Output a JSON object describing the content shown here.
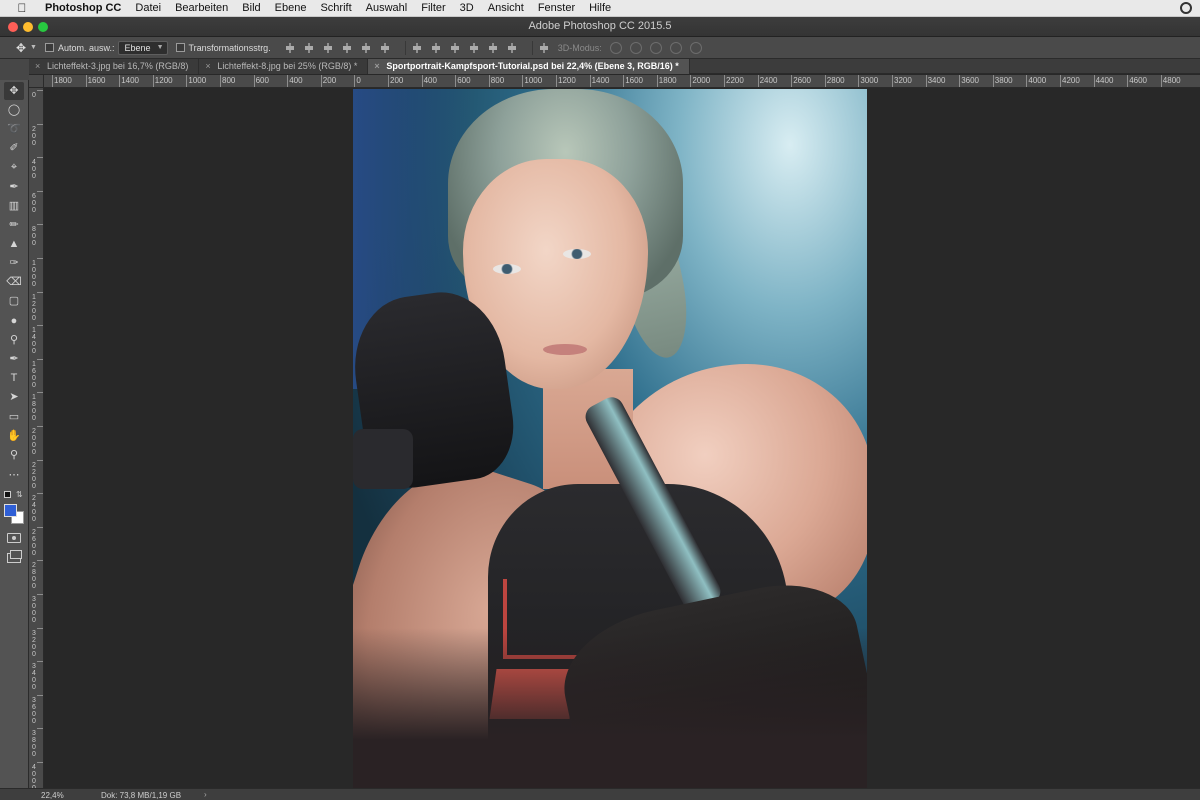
{
  "menubar": {
    "items": [
      "Photoshop CC",
      "Datei",
      "Bearbeiten",
      "Bild",
      "Ebene",
      "Schrift",
      "Auswahl",
      "Filter",
      "3D",
      "Ansicht",
      "Fenster",
      "Hilfe"
    ]
  },
  "window": {
    "title": "Adobe Photoshop CC 2015.5"
  },
  "options": {
    "auto_select_label": "Autom. ausw.:",
    "auto_select_value": "Ebene",
    "transform_label": "Transformationsstrg.",
    "mode_3d_label": "3D-Modus:"
  },
  "tabs": [
    {
      "label": "Lichteffekt-3.jpg bei 16,7% (RGB/8)",
      "active": false
    },
    {
      "label": "Lichteffekt-8.jpg bei 25% (RGB/8) *",
      "active": false
    },
    {
      "label": "Sportportrait-Kampfsport-Tutorial.psd bei 22,4% (Ebene 3, RGB/16) *",
      "active": true
    }
  ],
  "ruler": {
    "h_labels": [
      "1800",
      "1600",
      "1400",
      "1200",
      "1000",
      "800",
      "600",
      "400",
      "200",
      "0",
      "200",
      "400",
      "600",
      "800",
      "1000",
      "1200",
      "1400",
      "1600",
      "1800",
      "2000",
      "2200",
      "2400",
      "2600",
      "2800",
      "3000",
      "3200",
      "3400",
      "3600",
      "3800",
      "4000",
      "4200",
      "4400",
      "4600",
      "4800"
    ],
    "v_labels": [
      "0",
      "200",
      "400",
      "600",
      "800",
      "1000",
      "1200",
      "1400",
      "1600",
      "1800",
      "2000",
      "2200",
      "2400",
      "2600",
      "2800",
      "3000",
      "3200",
      "3400",
      "3600",
      "3800",
      "4000"
    ]
  },
  "tools": [
    "move-tool",
    "marquee-tool",
    "lasso-tool",
    "quick-select-tool",
    "crop-tool",
    "eyedropper-tool",
    "healing-brush-tool",
    "brush-tool",
    "clone-stamp-tool",
    "history-brush-tool",
    "eraser-tool",
    "gradient-tool",
    "blur-tool",
    "dodge-tool",
    "pen-tool",
    "type-tool",
    "path-select-tool",
    "rectangle-tool",
    "hand-tool",
    "zoom-tool",
    "more-tools"
  ],
  "colors": {
    "foreground": "#2f5fd6",
    "background": "#ffffff"
  },
  "status": {
    "zoom": "22,4%",
    "doc_size": "Dok: 73,8 MB/1,19 GB",
    "arrow": "›"
  }
}
